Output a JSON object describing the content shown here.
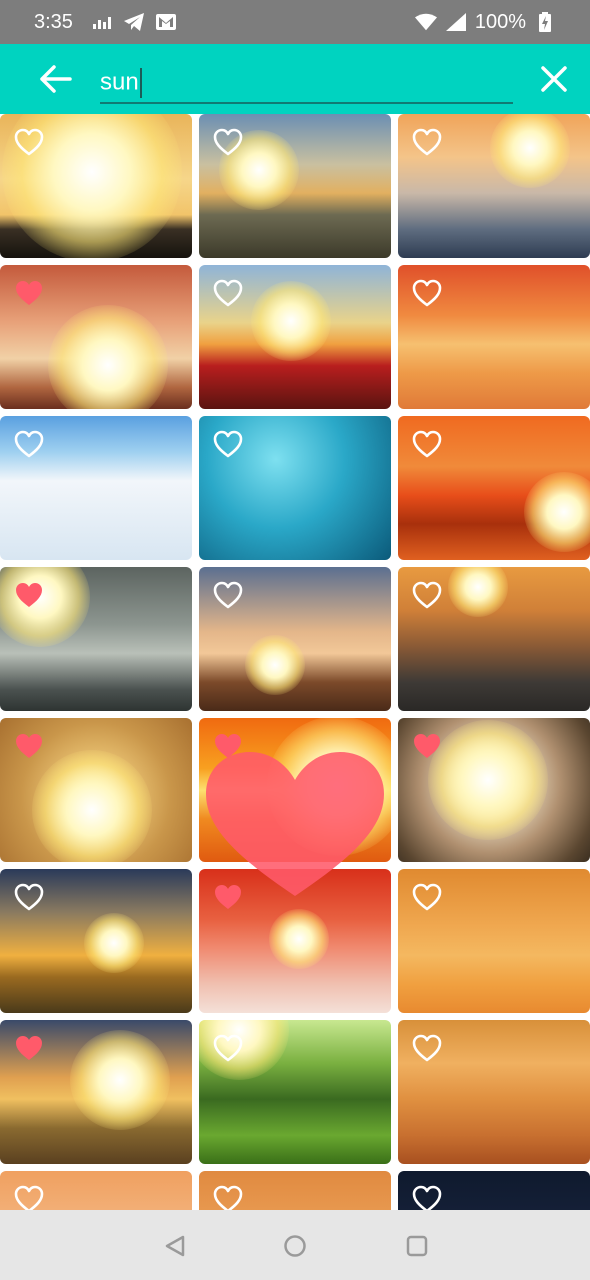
{
  "status_bar": {
    "time": "3:35",
    "battery": "100%",
    "icons": [
      "equalizer-icon",
      "telegram-icon",
      "gmail-icon",
      "wifi-icon",
      "signal-icon",
      "battery-icon"
    ]
  },
  "search": {
    "query": "sun",
    "back_icon": "arrow-left-icon",
    "close_icon": "close-icon"
  },
  "colors": {
    "accent": "#00d3c0",
    "heart_liked": "#ff5a6a",
    "heart_outline": "#ffffff"
  },
  "wallpapers": [
    {
      "liked": false
    },
    {
      "liked": false
    },
    {
      "liked": false
    },
    {
      "liked": true
    },
    {
      "liked": false
    },
    {
      "liked": false
    },
    {
      "liked": false
    },
    {
      "liked": false
    },
    {
      "liked": false
    },
    {
      "liked": true
    },
    {
      "liked": false
    },
    {
      "liked": false
    },
    {
      "liked": true
    },
    {
      "liked": true
    },
    {
      "liked": true
    },
    {
      "liked": false
    },
    {
      "liked": true
    },
    {
      "liked": false
    },
    {
      "liked": true
    },
    {
      "liked": false
    },
    {
      "liked": false
    },
    {
      "liked": false
    },
    {
      "liked": false
    },
    {
      "liked": false
    }
  ],
  "nav_bar": {
    "icons": [
      "back-triangle-icon",
      "home-circle-icon",
      "recents-square-icon"
    ]
  }
}
